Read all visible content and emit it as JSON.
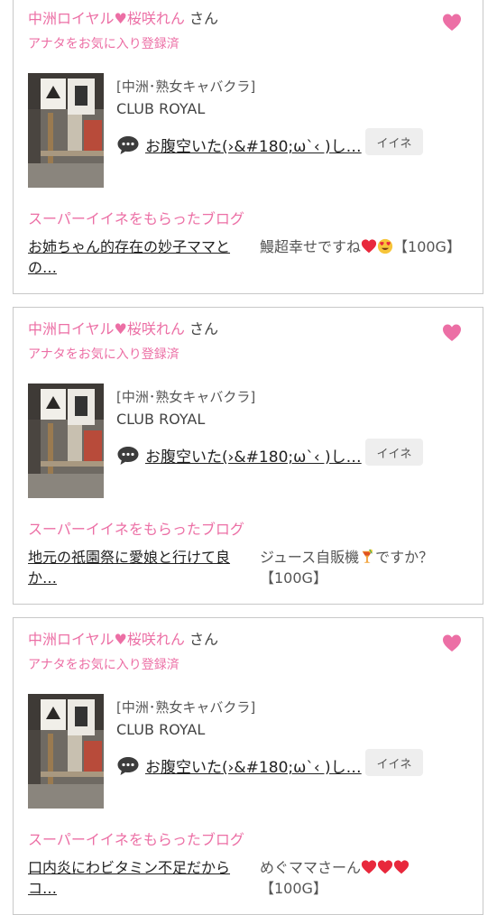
{
  "items": [
    {
      "sender_name": "中洲ロイヤル♥桜咲れん",
      "sender_suffix": "さん",
      "fav_status": "アナタをお気に入り登録済",
      "shop_category": "[中洲･熟女キャバクラ]",
      "shop_name": "CLUB ROYAL",
      "blog_title": "お腹空いた(›&#180;ω`‹ )し…",
      "iine_label": "イイネ",
      "super_label": "スーパーイイネをもらったブログ",
      "super_blog_title": "お姉ちゃん的存在の妙子ママとの…",
      "super_comment_pre": "鰻超幸せですね",
      "super_comment_post": "【100G】",
      "emoji": [
        "heart",
        "heart-eyes"
      ]
    },
    {
      "sender_name": "中洲ロイヤル♥桜咲れん",
      "sender_suffix": "さん",
      "fav_status": "アナタをお気に入り登録済",
      "shop_category": "[中洲･熟女キャバクラ]",
      "shop_name": "CLUB ROYAL",
      "blog_title": "お腹空いた(›&#180;ω`‹ )し…",
      "iine_label": "イイネ",
      "super_label": "スーパーイイネをもらったブログ",
      "super_blog_title": "地元の祇園祭に愛娘と行けて良か…",
      "super_comment_pre": "ジュース自販機",
      "super_comment_post": "ですか？【100G】",
      "emoji": [
        "tropical-drink"
      ]
    },
    {
      "sender_name": "中洲ロイヤル♥桜咲れん",
      "sender_suffix": "さん",
      "fav_status": "アナタをお気に入り登録済",
      "shop_category": "[中洲･熟女キャバクラ]",
      "shop_name": "CLUB ROYAL",
      "blog_title": "お腹空いた(›&#180;ω`‹ )し…",
      "iine_label": "イイネ",
      "super_label": "スーパーイイネをもらったブログ",
      "super_blog_title": "口内炎にわビタミン不足だからコ…",
      "super_comment_pre": "めぐママさーん",
      "super_comment_post": "【100G】",
      "emoji": [
        "heart",
        "heart",
        "heart"
      ]
    }
  ],
  "colors": {
    "accent_pink": "#ec6fa5",
    "heart_red": "#e8283c",
    "button_gray": "#eeeeee"
  },
  "icons": [
    "heart-icon",
    "speech-bubble-icon",
    "heart-emoji",
    "heart-eyes-emoji",
    "tropical-drink-emoji"
  ]
}
